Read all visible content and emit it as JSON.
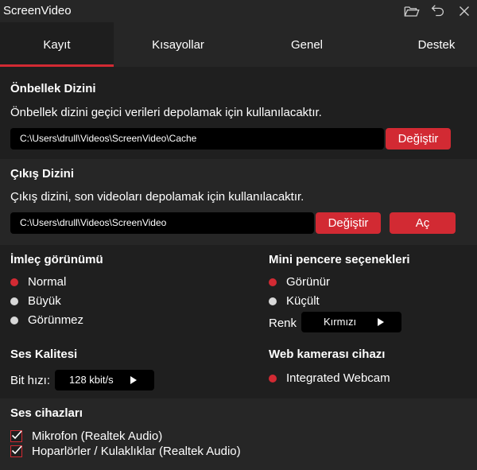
{
  "app": {
    "title": "ScreenVideo"
  },
  "titlebar": {
    "icons": [
      "folder-icon",
      "undo-icon",
      "close-icon"
    ]
  },
  "tabs": [
    {
      "label": "Kayıt",
      "active": true
    },
    {
      "label": "Kısayollar",
      "active": false
    },
    {
      "label": "Genel",
      "active": false
    },
    {
      "label": "Destek",
      "active": false
    }
  ],
  "cache": {
    "heading": "Önbellek Dizini",
    "description": "Önbellek dizini geçici verileri depolamak için kullanılacaktır.",
    "path": "C:\\Users\\drull\\Videos\\ScreenVideo\\Cache",
    "change_label": "Değiştir"
  },
  "output": {
    "heading": "Çıkış Dizini",
    "description": "Çıkış dizini, son videoları depolamak için kullanılacaktır.",
    "path": "C:\\Users\\drull\\Videos\\ScreenVideo",
    "change_label": "Değiştir",
    "open_label": "Aç"
  },
  "cursor": {
    "heading": "İmleç görünümü",
    "options": [
      {
        "label": "Normal",
        "selected": true
      },
      {
        "label": "Büyük",
        "selected": false
      },
      {
        "label": "Görünmez",
        "selected": false
      }
    ]
  },
  "mini_window": {
    "heading": "Mini pencere seçenekleri",
    "options": [
      {
        "label": "Görünür",
        "selected": true
      },
      {
        "label": "Küçült",
        "selected": false
      }
    ],
    "color_label": "Renk",
    "color_value": "Kırmızı"
  },
  "sound_quality": {
    "heading": "Ses Kalitesi",
    "bitrate_label": "Bit hızı:",
    "bitrate_value": "128 kbit/s"
  },
  "webcam": {
    "heading": "Web kamerası cihazı",
    "options": [
      {
        "label": "Integrated Webcam",
        "selected": true
      }
    ]
  },
  "audio_devices": {
    "heading": "Ses cihazları",
    "items": [
      {
        "label": "Mikrofon (Realtek Audio)",
        "checked": true
      },
      {
        "label": "Hoparlörler / Kulaklıklar (Realtek Audio)",
        "checked": true
      }
    ]
  },
  "colors": {
    "accent": "#d22a33",
    "background": "#262626",
    "panel": "#1f1f1f",
    "field": "#000000"
  }
}
